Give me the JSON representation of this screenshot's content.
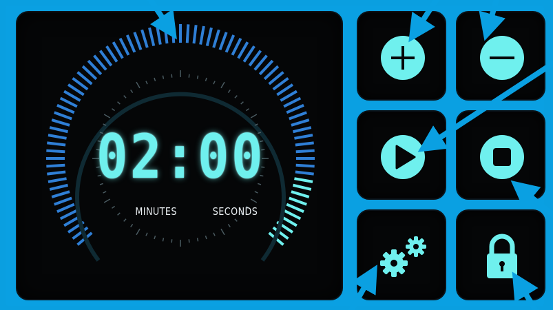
{
  "timer": {
    "minutes": "02",
    "seconds": "00",
    "display": "02:00",
    "minutes_label": "MINUTES",
    "seconds_label": "SECONDS"
  },
  "buttons": [
    {
      "name": "add",
      "icon": "plus-icon"
    },
    {
      "name": "subtract",
      "icon": "minus-icon"
    },
    {
      "name": "play",
      "icon": "play-icon"
    },
    {
      "name": "stop",
      "icon": "stop-icon"
    },
    {
      "name": "settings",
      "icon": "gears-icon"
    },
    {
      "name": "lock",
      "icon": "padlock-icon"
    }
  ],
  "colors": {
    "background": "#0aa0e2",
    "panel": "#050607",
    "accent": "#6ff0ee",
    "dial_blue": "#2f7fd6",
    "arrow": "#0aa0e2"
  }
}
